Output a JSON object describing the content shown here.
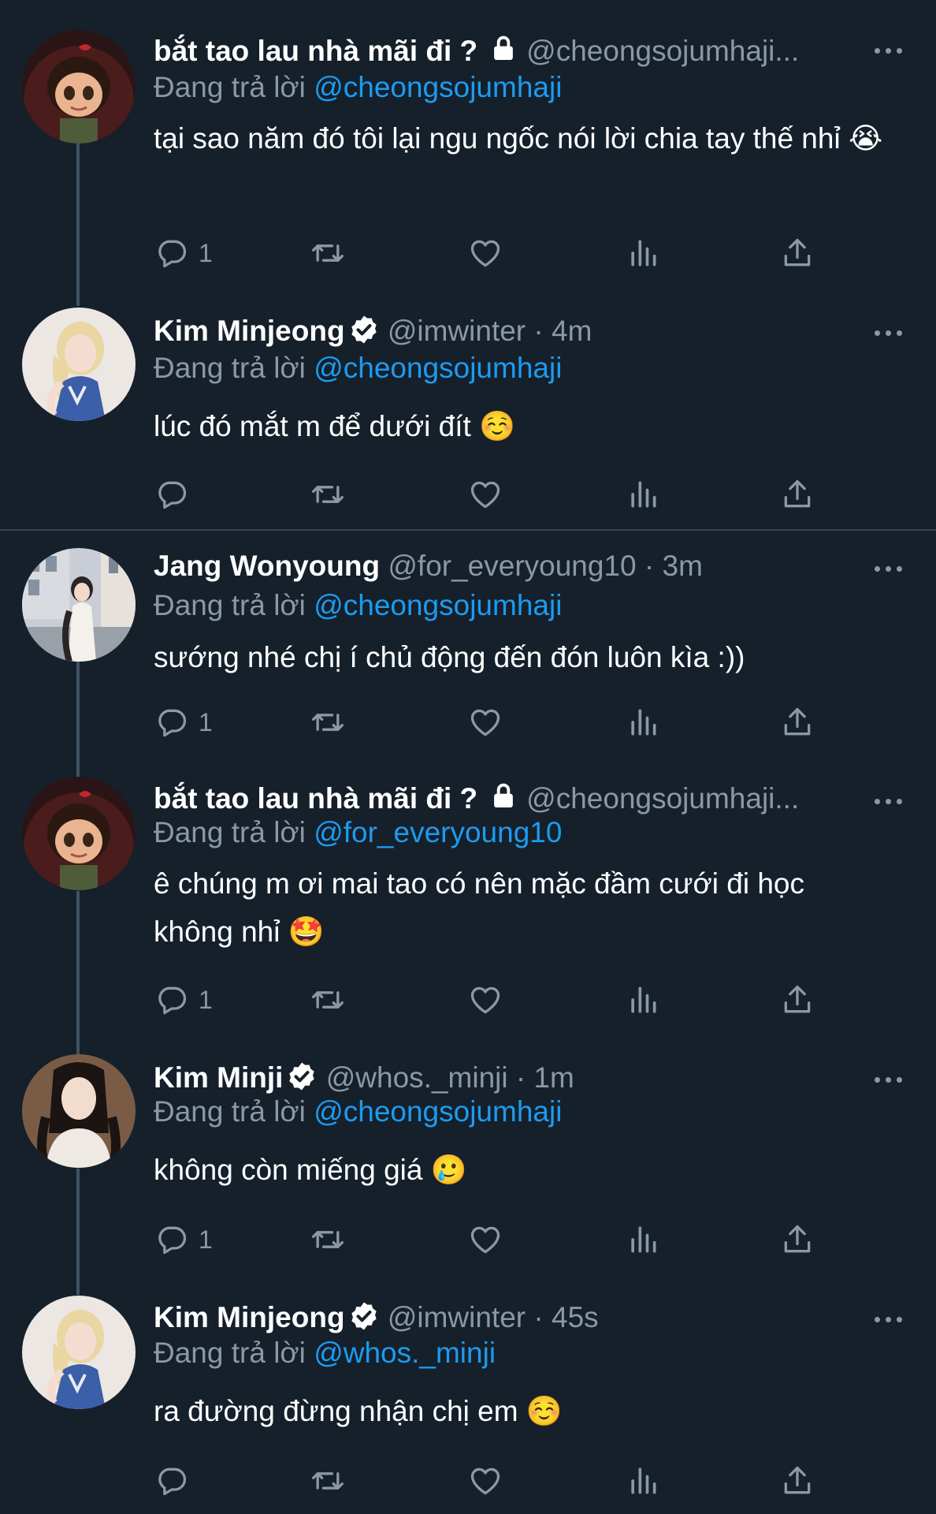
{
  "reply_prefix": "Đang trả lời",
  "colors": {
    "background": "#15202b",
    "text": "#ffffff",
    "secondary": "#8b98a5",
    "link": "#1d9bf0",
    "thread": "#3d5466"
  },
  "tweets": [
    {
      "name": "bắt tao lau nhà mãi đi ?",
      "protected": true,
      "handle": "@cheongsojumhaji...",
      "time": "",
      "reply_to": "@cheongsojumhaji",
      "text": "tại sao năm đó tôi lại ngu ngốc nói lời chia tay thế nhỉ 😭",
      "reply_count": "1",
      "avatar": "avatar-cartoon-girl"
    },
    {
      "name": "Kim Minjeong",
      "verified": true,
      "handle": "@imwinter",
      "time": "· 4m",
      "reply_to": "@cheongsojumhaji",
      "text": "lúc đó mắt m để dưới đít ☺️",
      "reply_count": "",
      "avatar": "avatar-blonde"
    },
    {
      "name": "Jang Wonyoung",
      "verified": false,
      "handle": "@for_everyoung10",
      "time": "· 3m",
      "reply_to": "@cheongsojumhaji",
      "text": "sướng nhé chị í chủ động đến đón luôn kìa :))",
      "reply_count": "1",
      "avatar": "avatar-street"
    },
    {
      "name": "bắt tao lau nhà mãi đi ?",
      "protected": true,
      "handle": "@cheongsojumhaji...",
      "time": "",
      "reply_to": "@for_everyoung10",
      "text": "ê chúng m ơi mai tao có nên mặc đầm cưới đi học không nhỉ 🤩",
      "reply_count": "1",
      "avatar": "avatar-cartoon-girl"
    },
    {
      "name": "Kim Minji",
      "verified": true,
      "handle": "@whos._minji",
      "time": "· 1m",
      "reply_to": "@cheongsojumhaji",
      "text": "không còn miếng giá 🥲",
      "reply_count": "1",
      "avatar": "avatar-dark-hair"
    },
    {
      "name": "Kim Minjeong",
      "verified": true,
      "handle": "@imwinter",
      "time": "· 45s",
      "reply_to": "@whos._minji",
      "text": "ra đường đừng nhận chị em ☺️",
      "reply_count": "",
      "avatar": "avatar-blonde"
    }
  ]
}
